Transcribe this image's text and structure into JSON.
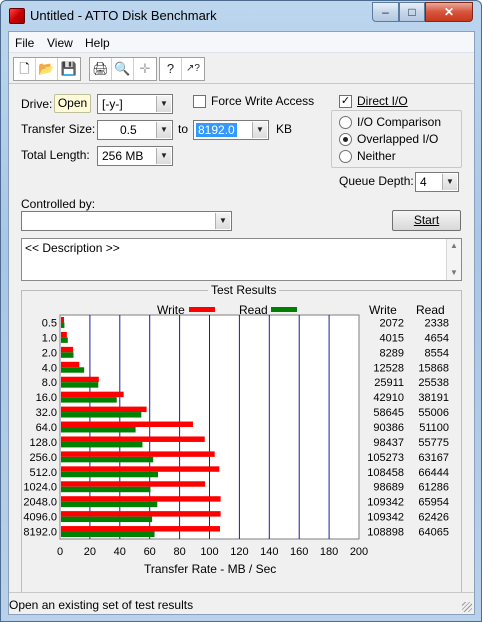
{
  "window": {
    "title": "Untitled - ATTO Disk Benchmark",
    "min_glyph": "–",
    "max_glyph": "□",
    "close_glyph": "✕"
  },
  "menu": [
    "File",
    "View",
    "Help"
  ],
  "toolbar": [
    {
      "icon": "new-document-icon",
      "glyph": "🗋"
    },
    {
      "icon": "open-folder-icon",
      "glyph": "📂"
    },
    {
      "icon": "save-disk-icon",
      "glyph": "💾"
    },
    {
      "icon": "print-icon",
      "glyph": "🖨"
    },
    {
      "icon": "print-preview-icon",
      "glyph": "🔍"
    },
    {
      "icon": "move-icon",
      "glyph": "✛"
    },
    {
      "icon": "help-icon",
      "glyph": "?"
    },
    {
      "icon": "context-help-icon",
      "glyph": "↗?"
    }
  ],
  "form": {
    "drive_label": "Drive:",
    "open_button": "Open",
    "drive_value": "[-y-]",
    "force_write_access": "Force Write Access",
    "direct_io": "Direct I/O",
    "transfer_size_label": "Transfer Size:",
    "transfer_from": "0.5",
    "to_label": "to",
    "transfer_to": "8192.0",
    "kb_label": "KB",
    "total_length_label": "Total Length:",
    "total_length": "256 MB",
    "io_comparison": "I/O Comparison",
    "overlapped_io": "Overlapped I/O",
    "neither": "Neither",
    "queue_depth_label": "Queue Depth:",
    "queue_depth": "4",
    "controlled_by_label": "Controlled by:",
    "controlled_by_value": "",
    "start_button": "Start",
    "description": "<< Description >>"
  },
  "results": {
    "title": "Test Results",
    "write_legend": "Write",
    "read_legend": "Read",
    "write_header": "Write",
    "read_header": "Read",
    "xlabel": "Transfer Rate - MB / Sec",
    "write_color": "#ff0000",
    "read_color": "#008000"
  },
  "chart_data": {
    "type": "bar",
    "orientation": "horizontal",
    "title": "Test Results",
    "xlabel": "Transfer Rate - MB / Sec",
    "xlim": [
      0,
      200
    ],
    "xticks": [
      "0",
      "20",
      "40",
      "60",
      "80",
      "100",
      "120",
      "140",
      "160",
      "180",
      "200"
    ],
    "categories": [
      "0.5",
      "1.0",
      "2.0",
      "4.0",
      "8.0",
      "16.0",
      "32.0",
      "64.0",
      "128.0",
      "256.0",
      "512.0",
      "1024.0",
      "2048.0",
      "4096.0",
      "8192.0"
    ],
    "series": [
      {
        "name": "Write",
        "color": "#ff0000",
        "values_kbs": [
          2072,
          4015,
          8289,
          12528,
          25911,
          42910,
          58645,
          90386,
          98437,
          105273,
          108458,
          98689,
          109342,
          109342,
          108898
        ]
      },
      {
        "name": "Read",
        "color": "#008000",
        "values_kbs": [
          2338,
          4654,
          8554,
          15868,
          25538,
          38191,
          55006,
          51100,
          55775,
          63167,
          66444,
          61286,
          65954,
          62426,
          64065
        ]
      }
    ],
    "grid": true,
    "legend": "top"
  },
  "status_bar": "Open an existing set of test results"
}
